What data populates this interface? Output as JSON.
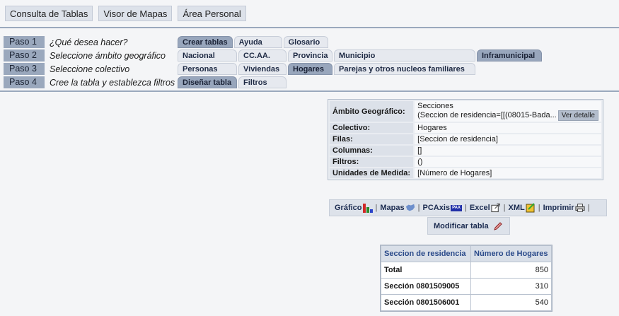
{
  "topnav": {
    "tabs": [
      {
        "label": "Consulta de Tablas"
      },
      {
        "label": "Visor de Mapas"
      },
      {
        "label": "Área Personal"
      }
    ]
  },
  "steps": [
    {
      "num": "Paso 1",
      "question": "¿Qué desea hacer?",
      "options": [
        {
          "label": "Crear tablas",
          "active": true
        },
        {
          "label": "Ayuda",
          "active": false
        },
        {
          "label": "Glosario",
          "active": false
        }
      ]
    },
    {
      "num": "Paso 2",
      "question": "Seleccione ámbito geográfico",
      "options": [
        {
          "label": "Nacional",
          "active": false
        },
        {
          "label": "CC.AA.",
          "active": false
        },
        {
          "label": "Provincia",
          "active": false
        },
        {
          "label": "Municipio",
          "active": false
        },
        {
          "label": "Inframunicipal",
          "active": true
        }
      ]
    },
    {
      "num": "Paso 3",
      "question": "Seleccione colectivo",
      "options": [
        {
          "label": "Personas",
          "active": false
        },
        {
          "label": "Viviendas",
          "active": false
        },
        {
          "label": "Hogares",
          "active": true
        },
        {
          "label": "Parejas y otros nucleos familiares",
          "active": false
        }
      ]
    },
    {
      "num": "Paso 4",
      "question": "Cree la tabla y establezca filtros",
      "options": [
        {
          "label": "Diseñar tabla",
          "active": true
        },
        {
          "label": "Filtros",
          "active": false
        }
      ]
    }
  ],
  "info": {
    "ambito_label": "Ámbito Geográfico:",
    "ambito_line1": "Secciones",
    "ambito_line2": "(Seccion de residencia=[[(08015-Bada...",
    "ver_detalle": "Ver detalle",
    "colectivo_label": "Colectivo:",
    "colectivo_value": "Hogares",
    "filas_label": "Filas:",
    "filas_value": "[Seccion de residencia]",
    "columnas_label": "Columnas:",
    "columnas_value": "[]",
    "filtros_label": "Filtros:",
    "filtros_value": "()",
    "unidades_label": "Unidades de Medida:",
    "unidades_value": "[Número de Hogares]"
  },
  "tools": {
    "grafico": "Gráfico",
    "mapas": "Mapas",
    "pcaxis": "PCAxis",
    "pcaxis_icon_text": "PAX",
    "excel": "Excel",
    "xml": "XML",
    "imprimir": "Imprimir",
    "separator": "|",
    "modificar": "Modificar tabla"
  },
  "results": {
    "headers": [
      "Seccion de residencia",
      "Número de Hogares"
    ],
    "rows": [
      {
        "label": "Total",
        "value": "850"
      },
      {
        "label": "Sección 0801509005",
        "value": "310"
      },
      {
        "label": "Sección 0801506001",
        "value": "540"
      }
    ]
  }
}
